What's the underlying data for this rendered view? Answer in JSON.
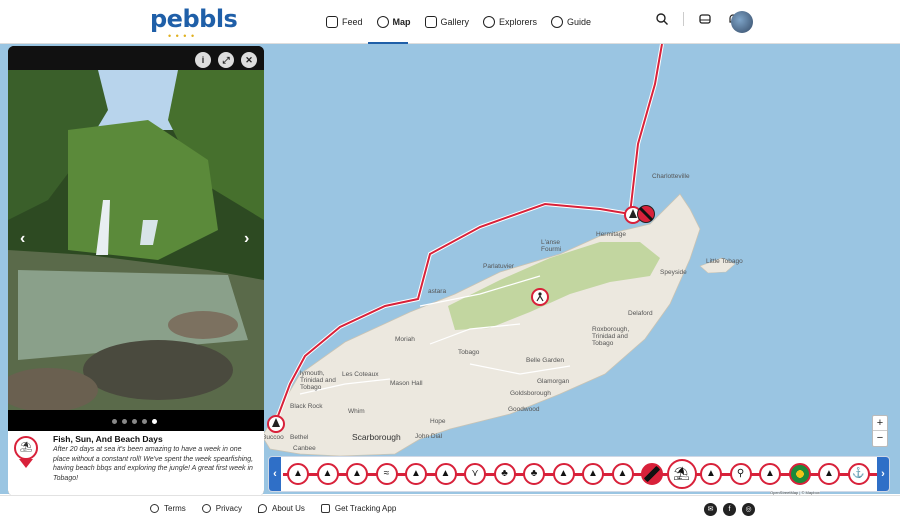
{
  "brand": {
    "name": "pebbls",
    "dots": "• • • •"
  },
  "nav": [
    {
      "label": "Feed",
      "icon": "feed-icon"
    },
    {
      "label": "Map",
      "icon": "map-icon",
      "active": true
    },
    {
      "label": "Gallery",
      "icon": "gallery-icon"
    },
    {
      "label": "Explorers",
      "icon": "explorers-icon"
    },
    {
      "label": "Guide",
      "icon": "guide-icon"
    }
  ],
  "header_icons": [
    "search-icon",
    "inbox-icon",
    "bell-icon",
    "avatar"
  ],
  "map": {
    "labels": {
      "charlotteville": "Charlotteville",
      "hermitage": "Hermitage",
      "lanse_fourmi": "L'anse\nFourmi",
      "parlatuvier": "Parlatuvier",
      "speyside": "Speyside",
      "little_tobago": "Little Tobago",
      "castara": "astara",
      "delaford": "Delaford",
      "moriah": "Moriah",
      "tobago": "Tobago",
      "roxborough": "Roxborough,\nTrinidad and\nTobago",
      "belle_garden": "Belle Garden",
      "glamorgan": "Glamorgan",
      "goldsborough": "Goldsborough",
      "goodwood": "Goodwood",
      "les_coteaux": "Les Coteaux",
      "mason_hall": "Mason Hall",
      "plymouth": "lymouth,\nTrinidad and\nTobago",
      "black_rock": "Black Rock",
      "whim": "Whim",
      "hope": "Hope",
      "scarborough": "Scarborough",
      "john_dial": "John Dial",
      "bethel": "Bethel",
      "buccoo": "Buccoo",
      "canbee": "Canbee"
    },
    "zoom_in": "+",
    "zoom_out": "−",
    "attribution": "OpenStreetMap | © Mapbox"
  },
  "panel": {
    "buttons": [
      "Info",
      "Expand",
      "Close"
    ],
    "prev": "‹",
    "next": "›",
    "dots": [
      false,
      false,
      false,
      false,
      true
    ],
    "title": "Fish, Sun, And Beach Days",
    "text": "After 20 days at sea it's been amazing to have a week in one place without a constant roll! We've spent the week spearfishing, having beach bbqs and exploring the jungle! A great first week in Tobago!"
  },
  "timeline": {
    "prev": "‹",
    "next": "›",
    "items": [
      "sailboat",
      "sailboat",
      "sailboat",
      "wave",
      "sailboat",
      "sailboat",
      "fish",
      "tree",
      "tree",
      "sailboat",
      "sailboat",
      "sailboat",
      "flag-trinidad",
      "beach",
      "sailboat",
      "hiker",
      "sailboat",
      "flag-grenada",
      "sailboat",
      "anchor"
    ],
    "selected_index": 13
  },
  "footer": {
    "links": [
      {
        "label": "Terms",
        "icon": "person-icon"
      },
      {
        "label": "Privacy",
        "icon": "people-icon"
      },
      {
        "label": "About Us",
        "icon": "pin-icon"
      },
      {
        "label": "Get Tracking App",
        "icon": "app-icon"
      }
    ],
    "social": [
      "mail-icon",
      "facebook-icon",
      "instagram-icon"
    ]
  }
}
